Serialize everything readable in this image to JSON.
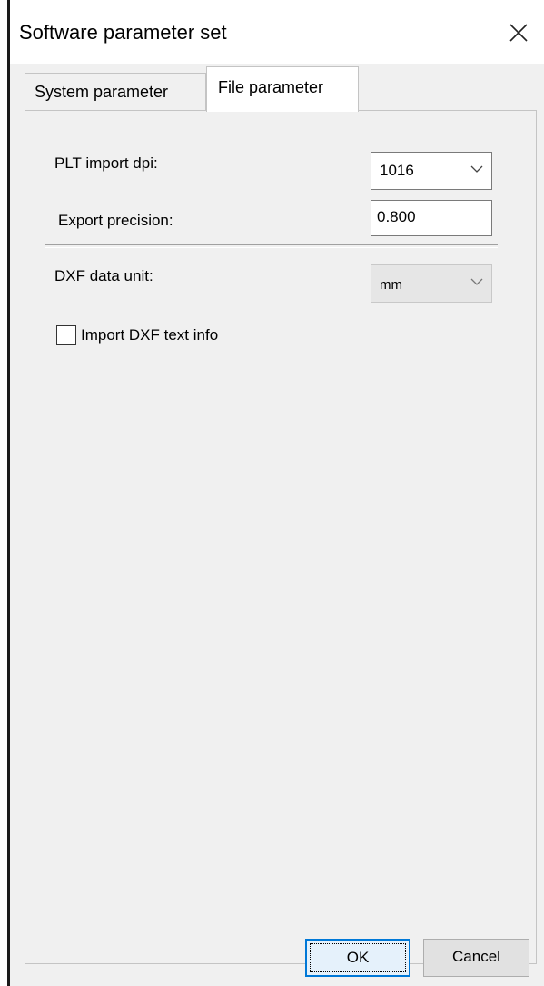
{
  "window": {
    "title": "Software parameter set",
    "close_icon": "close-icon"
  },
  "tabs": [
    {
      "label": "System parameter",
      "active": false
    },
    {
      "label": "File parameter",
      "active": true
    }
  ],
  "file_parameter": {
    "plt_import_dpi": {
      "label": "PLT import dpi:",
      "value": "1016"
    },
    "export_precision": {
      "label": "Export precision:",
      "value": "0.800"
    },
    "dxf_data_unit": {
      "label": "DXF data unit:",
      "value": "mm"
    },
    "import_dxf_text_info": {
      "label": "Import DXF text info",
      "checked": false
    }
  },
  "buttons": {
    "ok_label": "OK",
    "cancel_label": "Cancel"
  },
  "colors": {
    "dialog_bg": "#f0f0f0",
    "focus_accent": "#0078d7"
  }
}
